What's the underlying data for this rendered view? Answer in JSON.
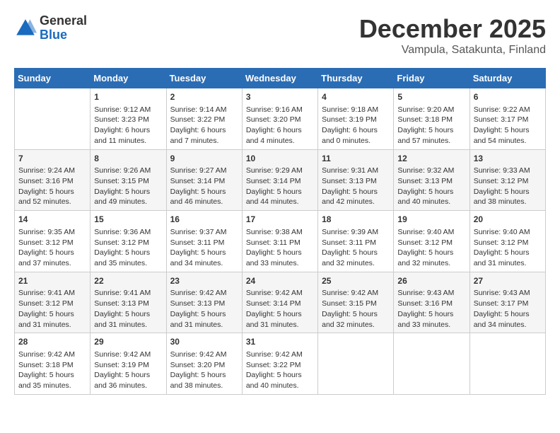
{
  "header": {
    "logo_general": "General",
    "logo_blue": "Blue",
    "month": "December 2025",
    "location": "Vampula, Satakunta, Finland"
  },
  "columns": [
    "Sunday",
    "Monday",
    "Tuesday",
    "Wednesday",
    "Thursday",
    "Friday",
    "Saturday"
  ],
  "weeks": [
    [
      {
        "day": "",
        "content": ""
      },
      {
        "day": "1",
        "content": "Sunrise: 9:12 AM\nSunset: 3:23 PM\nDaylight: 6 hours\nand 11 minutes."
      },
      {
        "day": "2",
        "content": "Sunrise: 9:14 AM\nSunset: 3:22 PM\nDaylight: 6 hours\nand 7 minutes."
      },
      {
        "day": "3",
        "content": "Sunrise: 9:16 AM\nSunset: 3:20 PM\nDaylight: 6 hours\nand 4 minutes."
      },
      {
        "day": "4",
        "content": "Sunrise: 9:18 AM\nSunset: 3:19 PM\nDaylight: 6 hours\nand 0 minutes."
      },
      {
        "day": "5",
        "content": "Sunrise: 9:20 AM\nSunset: 3:18 PM\nDaylight: 5 hours\nand 57 minutes."
      },
      {
        "day": "6",
        "content": "Sunrise: 9:22 AM\nSunset: 3:17 PM\nDaylight: 5 hours\nand 54 minutes."
      }
    ],
    [
      {
        "day": "7",
        "content": "Sunrise: 9:24 AM\nSunset: 3:16 PM\nDaylight: 5 hours\nand 52 minutes."
      },
      {
        "day": "8",
        "content": "Sunrise: 9:26 AM\nSunset: 3:15 PM\nDaylight: 5 hours\nand 49 minutes."
      },
      {
        "day": "9",
        "content": "Sunrise: 9:27 AM\nSunset: 3:14 PM\nDaylight: 5 hours\nand 46 minutes."
      },
      {
        "day": "10",
        "content": "Sunrise: 9:29 AM\nSunset: 3:14 PM\nDaylight: 5 hours\nand 44 minutes."
      },
      {
        "day": "11",
        "content": "Sunrise: 9:31 AM\nSunset: 3:13 PM\nDaylight: 5 hours\nand 42 minutes."
      },
      {
        "day": "12",
        "content": "Sunrise: 9:32 AM\nSunset: 3:13 PM\nDaylight: 5 hours\nand 40 minutes."
      },
      {
        "day": "13",
        "content": "Sunrise: 9:33 AM\nSunset: 3:12 PM\nDaylight: 5 hours\nand 38 minutes."
      }
    ],
    [
      {
        "day": "14",
        "content": "Sunrise: 9:35 AM\nSunset: 3:12 PM\nDaylight: 5 hours\nand 37 minutes."
      },
      {
        "day": "15",
        "content": "Sunrise: 9:36 AM\nSunset: 3:12 PM\nDaylight: 5 hours\nand 35 minutes."
      },
      {
        "day": "16",
        "content": "Sunrise: 9:37 AM\nSunset: 3:11 PM\nDaylight: 5 hours\nand 34 minutes."
      },
      {
        "day": "17",
        "content": "Sunrise: 9:38 AM\nSunset: 3:11 PM\nDaylight: 5 hours\nand 33 minutes."
      },
      {
        "day": "18",
        "content": "Sunrise: 9:39 AM\nSunset: 3:11 PM\nDaylight: 5 hours\nand 32 minutes."
      },
      {
        "day": "19",
        "content": "Sunrise: 9:40 AM\nSunset: 3:12 PM\nDaylight: 5 hours\nand 32 minutes."
      },
      {
        "day": "20",
        "content": "Sunrise: 9:40 AM\nSunset: 3:12 PM\nDaylight: 5 hours\nand 31 minutes."
      }
    ],
    [
      {
        "day": "21",
        "content": "Sunrise: 9:41 AM\nSunset: 3:12 PM\nDaylight: 5 hours\nand 31 minutes."
      },
      {
        "day": "22",
        "content": "Sunrise: 9:41 AM\nSunset: 3:13 PM\nDaylight: 5 hours\nand 31 minutes."
      },
      {
        "day": "23",
        "content": "Sunrise: 9:42 AM\nSunset: 3:13 PM\nDaylight: 5 hours\nand 31 minutes."
      },
      {
        "day": "24",
        "content": "Sunrise: 9:42 AM\nSunset: 3:14 PM\nDaylight: 5 hours\nand 31 minutes."
      },
      {
        "day": "25",
        "content": "Sunrise: 9:42 AM\nSunset: 3:15 PM\nDaylight: 5 hours\nand 32 minutes."
      },
      {
        "day": "26",
        "content": "Sunrise: 9:43 AM\nSunset: 3:16 PM\nDaylight: 5 hours\nand 33 minutes."
      },
      {
        "day": "27",
        "content": "Sunrise: 9:43 AM\nSunset: 3:17 PM\nDaylight: 5 hours\nand 34 minutes."
      }
    ],
    [
      {
        "day": "28",
        "content": "Sunrise: 9:42 AM\nSunset: 3:18 PM\nDaylight: 5 hours\nand 35 minutes."
      },
      {
        "day": "29",
        "content": "Sunrise: 9:42 AM\nSunset: 3:19 PM\nDaylight: 5 hours\nand 36 minutes."
      },
      {
        "day": "30",
        "content": "Sunrise: 9:42 AM\nSunset: 3:20 PM\nDaylight: 5 hours\nand 38 minutes."
      },
      {
        "day": "31",
        "content": "Sunrise: 9:42 AM\nSunset: 3:22 PM\nDaylight: 5 hours\nand 40 minutes."
      },
      {
        "day": "",
        "content": ""
      },
      {
        "day": "",
        "content": ""
      },
      {
        "day": "",
        "content": ""
      }
    ]
  ]
}
